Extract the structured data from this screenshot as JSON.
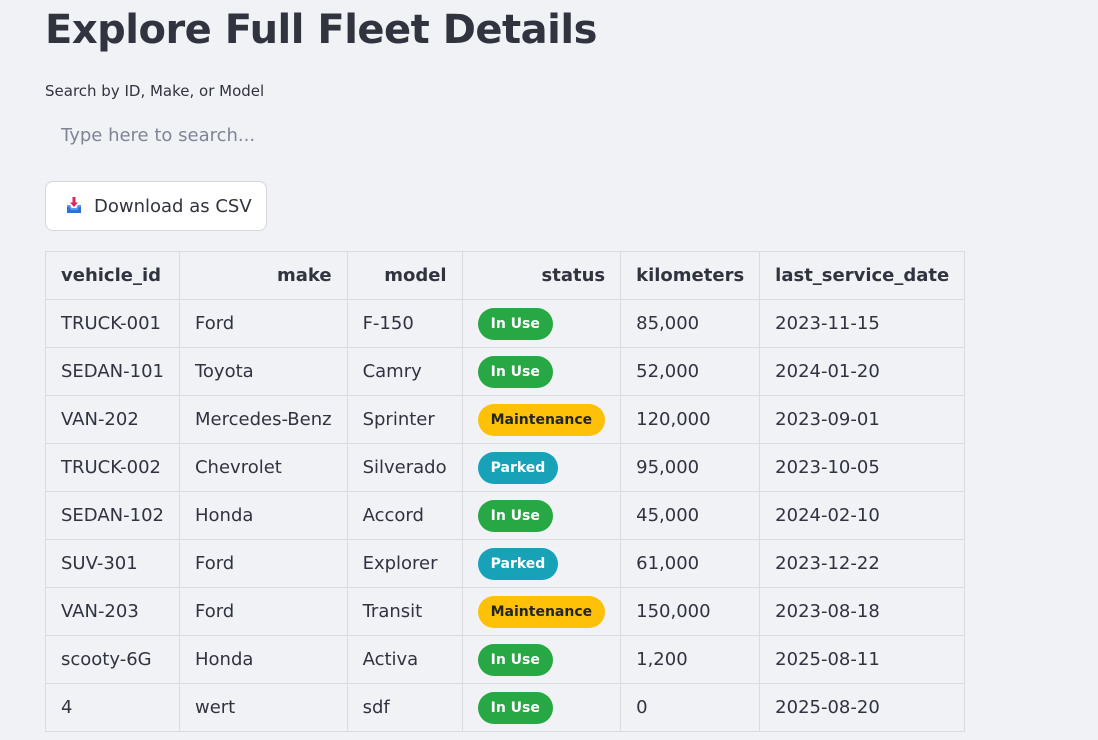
{
  "page": {
    "title": "Explore Full Fleet Details"
  },
  "search": {
    "label": "Search by ID, Make, or Model",
    "placeholder": "Type here to search...",
    "value": ""
  },
  "download": {
    "label": "Download as CSV",
    "icon": "inbox-tray-icon"
  },
  "colors": {
    "in_use": "#28a745",
    "maintenance": "#ffc107",
    "parked": "#17a2b8"
  },
  "table": {
    "columns": [
      "vehicle_id",
      "make",
      "model",
      "status",
      "kilometers",
      "last_service_date"
    ],
    "rows": [
      {
        "vehicle_id": "TRUCK-001",
        "make": "Ford",
        "model": "F-150",
        "status": "In Use",
        "kilometers": "85,000",
        "last_service_date": "2023-11-15"
      },
      {
        "vehicle_id": "SEDAN-101",
        "make": "Toyota",
        "model": "Camry",
        "status": "In Use",
        "kilometers": "52,000",
        "last_service_date": "2024-01-20"
      },
      {
        "vehicle_id": "VAN-202",
        "make": "Mercedes-Benz",
        "model": "Sprinter",
        "status": "Maintenance",
        "kilometers": "120,000",
        "last_service_date": "2023-09-01"
      },
      {
        "vehicle_id": "TRUCK-002",
        "make": "Chevrolet",
        "model": "Silverado",
        "status": "Parked",
        "kilometers": "95,000",
        "last_service_date": "2023-10-05"
      },
      {
        "vehicle_id": "SEDAN-102",
        "make": "Honda",
        "model": "Accord",
        "status": "In Use",
        "kilometers": "45,000",
        "last_service_date": "2024-02-10"
      },
      {
        "vehicle_id": "SUV-301",
        "make": "Ford",
        "model": "Explorer",
        "status": "Parked",
        "kilometers": "61,000",
        "last_service_date": "2023-12-22"
      },
      {
        "vehicle_id": "VAN-203",
        "make": "Ford",
        "model": "Transit",
        "status": "Maintenance",
        "kilometers": "150,000",
        "last_service_date": "2023-08-18"
      },
      {
        "vehicle_id": "scooty-6G",
        "make": "Honda",
        "model": "Activa",
        "status": "In Use",
        "kilometers": "1,200",
        "last_service_date": "2025-08-11"
      },
      {
        "vehicle_id": "4",
        "make": "wert",
        "model": "sdf",
        "status": "In Use",
        "kilometers": "0",
        "last_service_date": "2025-08-20"
      }
    ]
  }
}
